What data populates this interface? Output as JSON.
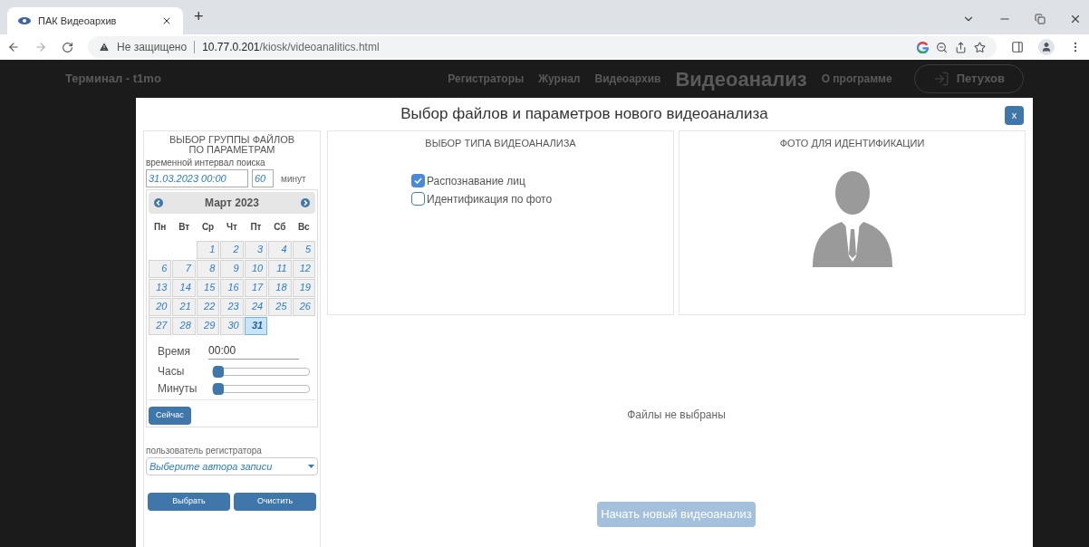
{
  "browser": {
    "tab_title": "ПАК Видеоархив",
    "new_tab": "+",
    "security": "Не защищено",
    "url_host": "10.77.0.201",
    "url_path": "/kiosk/videoanalitics.html"
  },
  "header": {
    "terminal": "Терминал - t1mo",
    "nav": [
      {
        "label": "Регистраторы",
        "selected": false
      },
      {
        "label": "Журнал",
        "selected": false
      },
      {
        "label": "Видеоархив",
        "selected": false
      },
      {
        "label": "Видеоанализ",
        "selected": true
      },
      {
        "label": "О программе",
        "selected": false
      }
    ],
    "user": "Петухов"
  },
  "modal": {
    "title": "Выбор файлов и параметров нового видеоанализа",
    "close": "x",
    "filter": {
      "title": "ВЫБОР ГРУППЫ ФАЙЛОВ ПО ПАРАМЕТРАМ",
      "interval_label": "временной интервал поиска",
      "datetime": "31.03.2023 00:00",
      "minutes": "60",
      "minutes_unit": "минут",
      "calendar": {
        "month": "Март 2023",
        "weekdays": [
          "Пн",
          "Вт",
          "Ср",
          "Чт",
          "Пт",
          "Сб",
          "Вс"
        ],
        "days": [
          {
            "d": "1",
            "selected": false
          },
          {
            "d": "2",
            "selected": false
          },
          {
            "d": "3",
            "selected": false
          },
          {
            "d": "4",
            "selected": false
          },
          {
            "d": "5",
            "selected": false
          },
          {
            "d": "6",
            "selected": false
          },
          {
            "d": "7",
            "selected": false
          },
          {
            "d": "8",
            "selected": false
          },
          {
            "d": "9",
            "selected": false
          },
          {
            "d": "10",
            "selected": false
          },
          {
            "d": "11",
            "selected": false
          },
          {
            "d": "12",
            "selected": false
          },
          {
            "d": "13",
            "selected": false
          },
          {
            "d": "14",
            "selected": false
          },
          {
            "d": "15",
            "selected": false
          },
          {
            "d": "16",
            "selected": false
          },
          {
            "d": "17",
            "selected": false
          },
          {
            "d": "18",
            "selected": false
          },
          {
            "d": "19",
            "selected": false
          },
          {
            "d": "20",
            "selected": false
          },
          {
            "d": "21",
            "selected": false
          },
          {
            "d": "22",
            "selected": false
          },
          {
            "d": "23",
            "selected": false
          },
          {
            "d": "24",
            "selected": false
          },
          {
            "d": "25",
            "selected": false
          },
          {
            "d": "26",
            "selected": false
          },
          {
            "d": "27",
            "selected": false
          },
          {
            "d": "28",
            "selected": false
          },
          {
            "d": "29",
            "selected": false
          },
          {
            "d": "30",
            "selected": false
          },
          {
            "d": "31",
            "selected": true
          }
        ],
        "time_label": "Время",
        "time": "00:00",
        "sliders": [
          {
            "label": "Часы",
            "level": 0
          },
          {
            "label": "Минуты",
            "level": 0
          }
        ],
        "now_button": "Сейчас"
      },
      "user_label": "пользователь регистратора",
      "user_select": "Выберите автора записи",
      "buttons": [
        "Выбрать",
        "Очистить"
      ]
    },
    "type": {
      "title": "ВЫБОР ТИПА ВИДЕОАНАЛИЗА",
      "options": [
        {
          "label": "Распознавание лиц",
          "checked": true
        },
        {
          "label": "Идентификация по фото",
          "checked": false
        }
      ]
    },
    "photo": {
      "title": "ФОТО ДЛЯ ИДЕНТИФИКАЦИИ"
    },
    "files_status": "Файлы не выбраны",
    "start_button": {
      "label": "Начать новый видеоанализ",
      "disabled": true
    }
  }
}
